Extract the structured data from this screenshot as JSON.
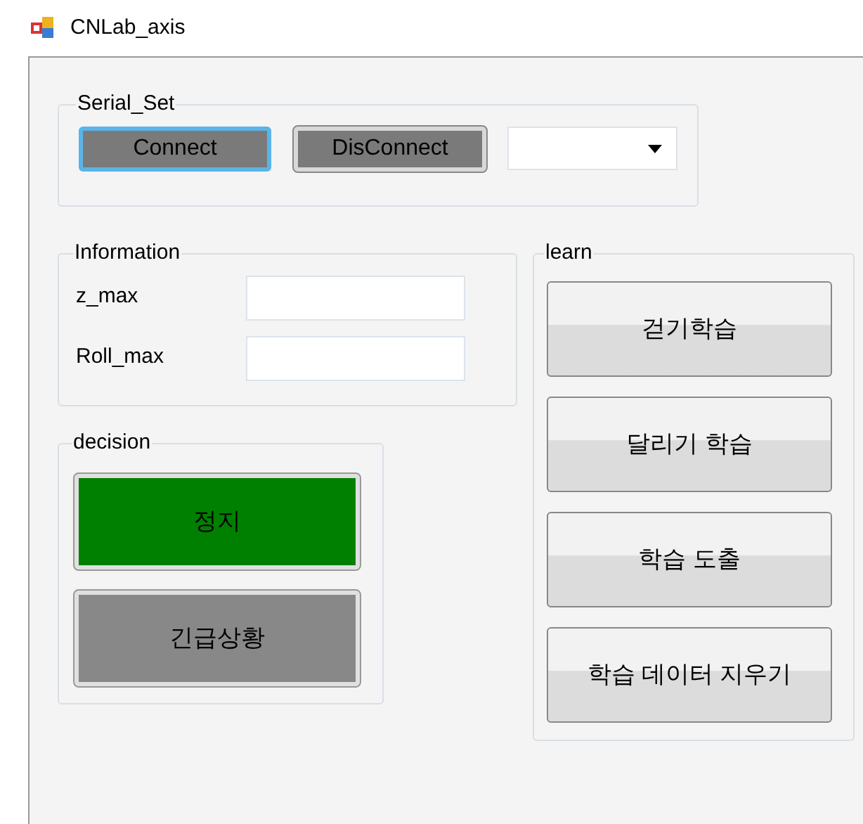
{
  "window": {
    "title": "CNLab_axis"
  },
  "serial_set": {
    "title": "Serial_Set",
    "buttons": [
      {
        "label": "Connect",
        "focused": true
      },
      {
        "label": "DisConnect",
        "focused": false
      }
    ]
  },
  "information": {
    "title": "Information",
    "fields": [
      {
        "label": "z_max"
      },
      {
        "label": "Roll_max"
      }
    ]
  },
  "decision": {
    "title": "decision",
    "buttons": [
      {
        "label": "정지",
        "color": "#008000"
      },
      {
        "label": "긴급상황",
        "color": "#888888"
      }
    ]
  },
  "learn": {
    "title": "learn",
    "buttons": [
      {
        "label": "걷기학습"
      },
      {
        "label": "달리기 학습"
      },
      {
        "label": "학습 도출"
      },
      {
        "label": "학습 데이터 지우기"
      }
    ]
  }
}
